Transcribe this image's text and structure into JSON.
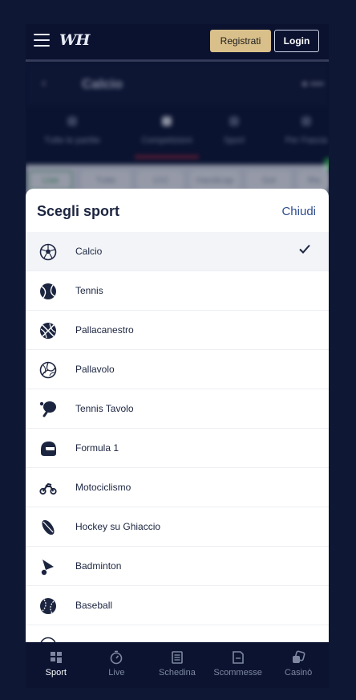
{
  "header": {
    "logo_text": "WH",
    "register_label": "Registrati",
    "login_label": "Login"
  },
  "background_page": {
    "title": "Calcio",
    "tabs": [
      "Tutte le partite",
      "Competizioni",
      "Sport",
      "Per Fascia"
    ],
    "chips": [
      "Live",
      "Tutte",
      "1X2",
      "Handicap",
      "Gol",
      "Ris"
    ]
  },
  "sheet": {
    "title": "Scegli sport",
    "close_label": "Chiudi",
    "sports": [
      {
        "label": "Calcio",
        "icon": "soccer-ball-icon",
        "selected": true
      },
      {
        "label": "Tennis",
        "icon": "tennis-ball-icon",
        "selected": false
      },
      {
        "label": "Pallacanestro",
        "icon": "basketball-icon",
        "selected": false
      },
      {
        "label": "Pallavolo",
        "icon": "volleyball-icon",
        "selected": false
      },
      {
        "label": "Tennis Tavolo",
        "icon": "table-tennis-icon",
        "selected": false
      },
      {
        "label": "Formula 1",
        "icon": "helmet-icon",
        "selected": false
      },
      {
        "label": "Motociclismo",
        "icon": "motorbike-icon",
        "selected": false
      },
      {
        "label": "Hockey su Ghiaccio",
        "icon": "ice-hockey-icon",
        "selected": false
      },
      {
        "label": "Badminton",
        "icon": "shuttlecock-icon",
        "selected": false
      },
      {
        "label": "Baseball",
        "icon": "baseball-icon",
        "selected": false
      }
    ]
  },
  "bottom_nav": [
    {
      "label": "Sport",
      "icon": "sport-icon",
      "active": true
    },
    {
      "label": "Live",
      "icon": "stopwatch-icon",
      "active": false
    },
    {
      "label": "Schedina",
      "icon": "betslip-icon",
      "active": false
    },
    {
      "label": "Scommesse",
      "icon": "my-bets-icon",
      "active": false
    },
    {
      "label": "Casinò",
      "icon": "dice-icon",
      "active": false
    }
  ],
  "colors": {
    "background": "#0e1733",
    "register_button": "#d9c08a",
    "accent_link": "#2d4b8e",
    "sheet_text": "#1c2540"
  }
}
